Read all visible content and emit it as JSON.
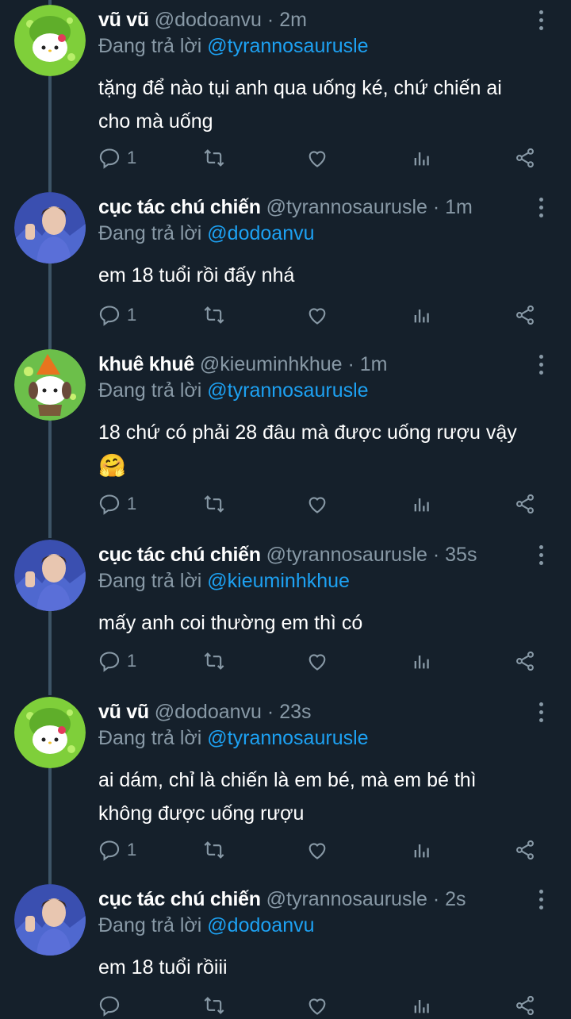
{
  "replying_to_label": "Đang trả lời",
  "tweets": [
    {
      "name": "vũ vũ",
      "handle": "@dodoanvu",
      "time": "· 2m",
      "reply_to": "@tyrannosaurusle",
      "text_lines": [
        "tặng để nào tụi anh qua uống ké, chứ chiến ai",
        "cho mà uống"
      ],
      "reply_count": "1",
      "avatar": "green-kitty-avatar"
    },
    {
      "name": "cục tác chú chiến",
      "handle": "@tyrannosaurusle",
      "time": "· 1m",
      "reply_to": "@dodoanvu",
      "text_lines": [
        "em 18 tuổi rồi đấy nhá"
      ],
      "reply_count": "1",
      "avatar": "boy-photo-avatar"
    },
    {
      "name": "khuê khuê",
      "handle": "@kieuminhkhue",
      "time": "· 1m",
      "reply_to": "@tyrannosaurusle",
      "text_lines": [
        "18 chứ có phải 28 đâu mà được uống rượu vậy"
      ],
      "emoji": "🤗",
      "reply_count": "1",
      "avatar": "dog-hat-avatar"
    },
    {
      "name": "cục tác chú chiến",
      "handle": "@tyrannosaurusle",
      "time": "· 35s",
      "reply_to": "@kieuminhkhue",
      "text_lines": [
        "mấy anh coi thường em thì có"
      ],
      "reply_count": "1",
      "avatar": "boy-photo-avatar"
    },
    {
      "name": "vũ vũ",
      "handle": "@dodoanvu",
      "time": "· 23s",
      "reply_to": "@tyrannosaurusle",
      "text_lines": [
        "ai dám, chỉ là chiến là em bé, mà em bé thì",
        "không được uống rượu"
      ],
      "reply_count": "1",
      "avatar": "green-kitty-avatar"
    },
    {
      "name": "cục tác chú chiến",
      "handle": "@tyrannosaurusle",
      "time": "· 2s",
      "reply_to": "@dodoanvu",
      "text_lines": [
        "em 18 tuổi rồiii"
      ],
      "reply_count": "",
      "avatar": "boy-photo-avatar"
    }
  ],
  "colors": {
    "background": "#15202b",
    "muted": "#8899a6",
    "link": "#1da1f2",
    "thread_line": "#3d5466"
  },
  "icons": [
    "reply-icon",
    "retweet-icon",
    "like-icon",
    "analytics-icon",
    "share-icon",
    "more-icon"
  ]
}
